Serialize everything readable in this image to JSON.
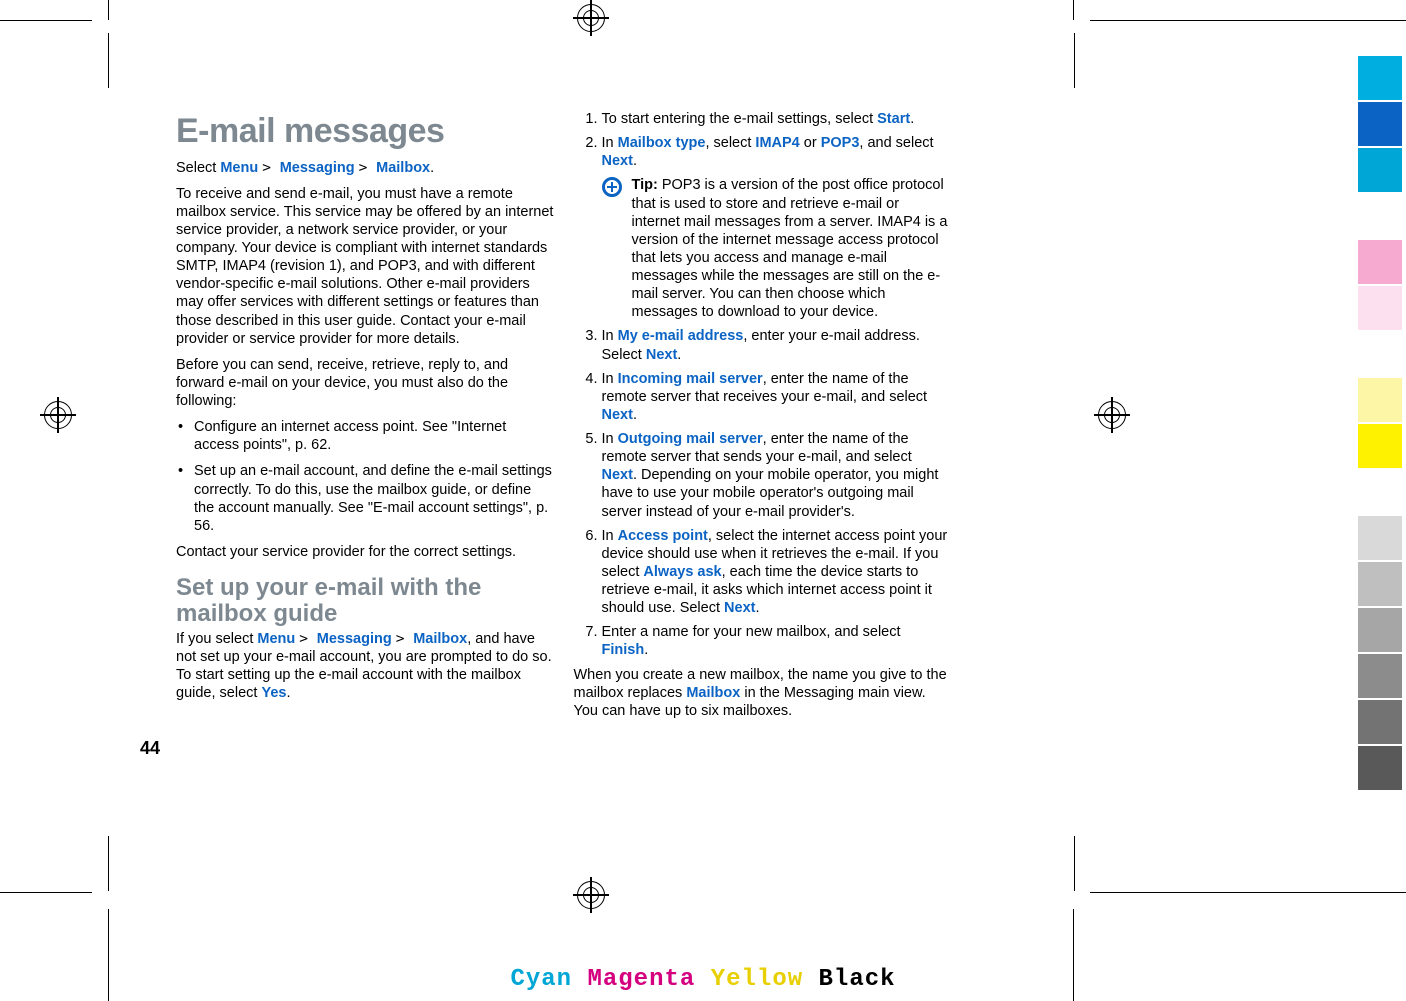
{
  "page_number": "44",
  "left": {
    "heading": "E-mail messages",
    "nav_prefix": "Select ",
    "nav_menu": "Menu",
    "nav_messaging": "Messaging",
    "nav_mailbox": "Mailbox",
    "p1": "To receive and send e-mail, you must have a remote mailbox service. This service may be offered by an internet service provider, a network service provider, or your company. Your device is compliant with internet standards SMTP, IMAP4 (revision 1), and POP3, and with different vendor-specific e-mail solutions. Other e-mail providers may offer services with different settings or features than those described in this user guide. Contact your e-mail provider or service provider for more details.",
    "p2": "Before you can send, receive, retrieve, reply to, and forward e-mail on your device, you must also do the following:",
    "bul1": "Configure an internet access point. See \"Internet access points\", p. 62.",
    "bul2": "Set up an e-mail account, and define the e-mail settings correctly. To do this, use the mailbox guide, or define the account manually. See \"E-mail account settings\", p. 56.",
    "p3": "Contact your service provider for the correct settings.",
    "sub_heading": "Set up your e-mail with the mailbox guide",
    "p4_a": "If you select ",
    "p4_b": ", and have not set up your e-mail account, you are prompted to do so. To start setting up the e-mail account with the mailbox guide, select ",
    "yes": "Yes"
  },
  "right": {
    "s1_a": "To start entering the e-mail settings, select ",
    "s1_start": "Start",
    "s2_a": "In ",
    "s2_mbtype": "Mailbox type",
    "s2_b": ", select ",
    "s2_imap": "IMAP4",
    "s2_or": " or ",
    "s2_pop3": "POP3",
    "s2_c": ", and select ",
    "s2_next": "Next",
    "tip_label": "Tip:",
    "tip_text": " POP3 is a version of the post office protocol that is used to store and retrieve e-mail or internet mail messages from a server. IMAP4 is a version of the internet message access protocol that lets you access and manage e-mail messages while the messages are still on the e-mail server. You can then choose which messages to download to your device.",
    "s3_a": "In ",
    "s3_addr": "My e-mail address",
    "s3_b": ", enter your e-mail address. Select ",
    "s3_next": "Next",
    "s4_a": "In ",
    "s4_inc": "Incoming mail server",
    "s4_b": ", enter the name of the remote server that receives your e-mail, and select ",
    "s4_next": "Next",
    "s5_a": "In ",
    "s5_out": "Outgoing mail server",
    "s5_b": ", enter the name of the remote server that sends your e-mail, and select ",
    "s5_next": "Next",
    "s5_c": ". Depending on your mobile operator, you might have to use your mobile operator's outgoing mail server instead of your e-mail provider's.",
    "s6_a": "In ",
    "s6_ap": "Access point",
    "s6_b": ", select the internet access point your device should use when it retrieves the e-mail. If you select ",
    "s6_always": "Always ask",
    "s6_c": ", each time the device starts to retrieve e-mail, it asks which internet access point it should use. Select ",
    "s6_next": "Next",
    "s7_a": "Enter a name for your new mailbox, and select ",
    "s7_finish": "Finish",
    "closing_a": "When you create a new mailbox, the name you give to the mailbox replaces ",
    "closing_mb": "Mailbox",
    "closing_b": " in the Messaging main view. You can have up to six mailboxes."
  },
  "cmyk": {
    "c": "Cyan",
    "m": "Magenta",
    "y": "Yellow",
    "k": "Black"
  },
  "swatches": {
    "cyan": "#00aee0",
    "blue": "#0b63c4",
    "pink": "#f7aacf",
    "ltpink": "#fce0ef",
    "ltyel": "#fdf6a7",
    "yellow": "#fff200",
    "g1": "#d9d9d9",
    "g2": "#bfbfbf",
    "g3": "#a6a6a6",
    "g4": "#8c8c8c",
    "g5": "#737373",
    "g6": "#595959"
  }
}
